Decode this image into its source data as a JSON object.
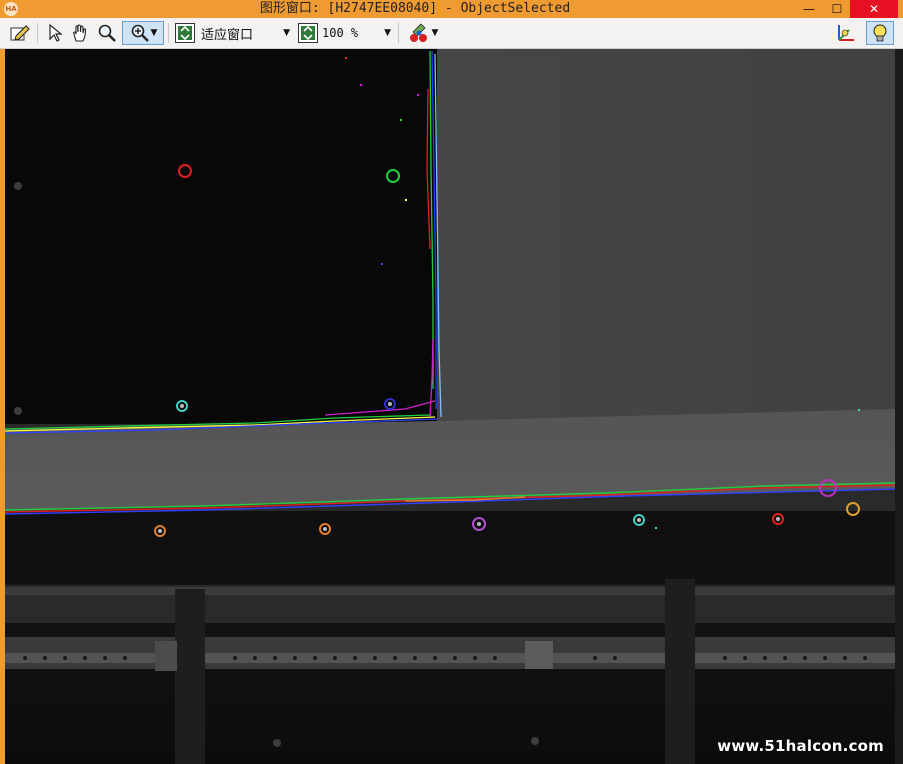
{
  "window": {
    "title": "图形窗口: [H2747EE08040] - ObjectSelected",
    "app_icon_text": "HA",
    "minimize_glyph": "—",
    "maximize_glyph": "☐",
    "close_glyph": "✕"
  },
  "toolbar": {
    "zoom_mode_label": "适应窗口",
    "zoom_percent": "100 %",
    "icons": [
      "edit-icon",
      "pointer-icon",
      "pan-hand-icon",
      "magnify-icon",
      "zoom-in-icon",
      "fit-window-icon",
      "zoom-percent-icon",
      "color-palette-icon",
      "axes-icon",
      "lightbulb-icon"
    ]
  },
  "watermark": "www.51halcon.com",
  "colors": {
    "title_bar": "#f09a32",
    "toolbar": "#f3f2f0",
    "close_button": "#e81123",
    "dark_panel": "#0a0a0a",
    "plate": "#474747",
    "beam": "#5a5a5a"
  },
  "marker_colors": [
    "#e02020",
    "#20d040",
    "#40d0c0",
    "#3030d0",
    "#e08030",
    "#e08030",
    "#b050d0",
    "#40d0c0",
    "#e02020",
    "#e0a030",
    "#c030c0"
  ]
}
